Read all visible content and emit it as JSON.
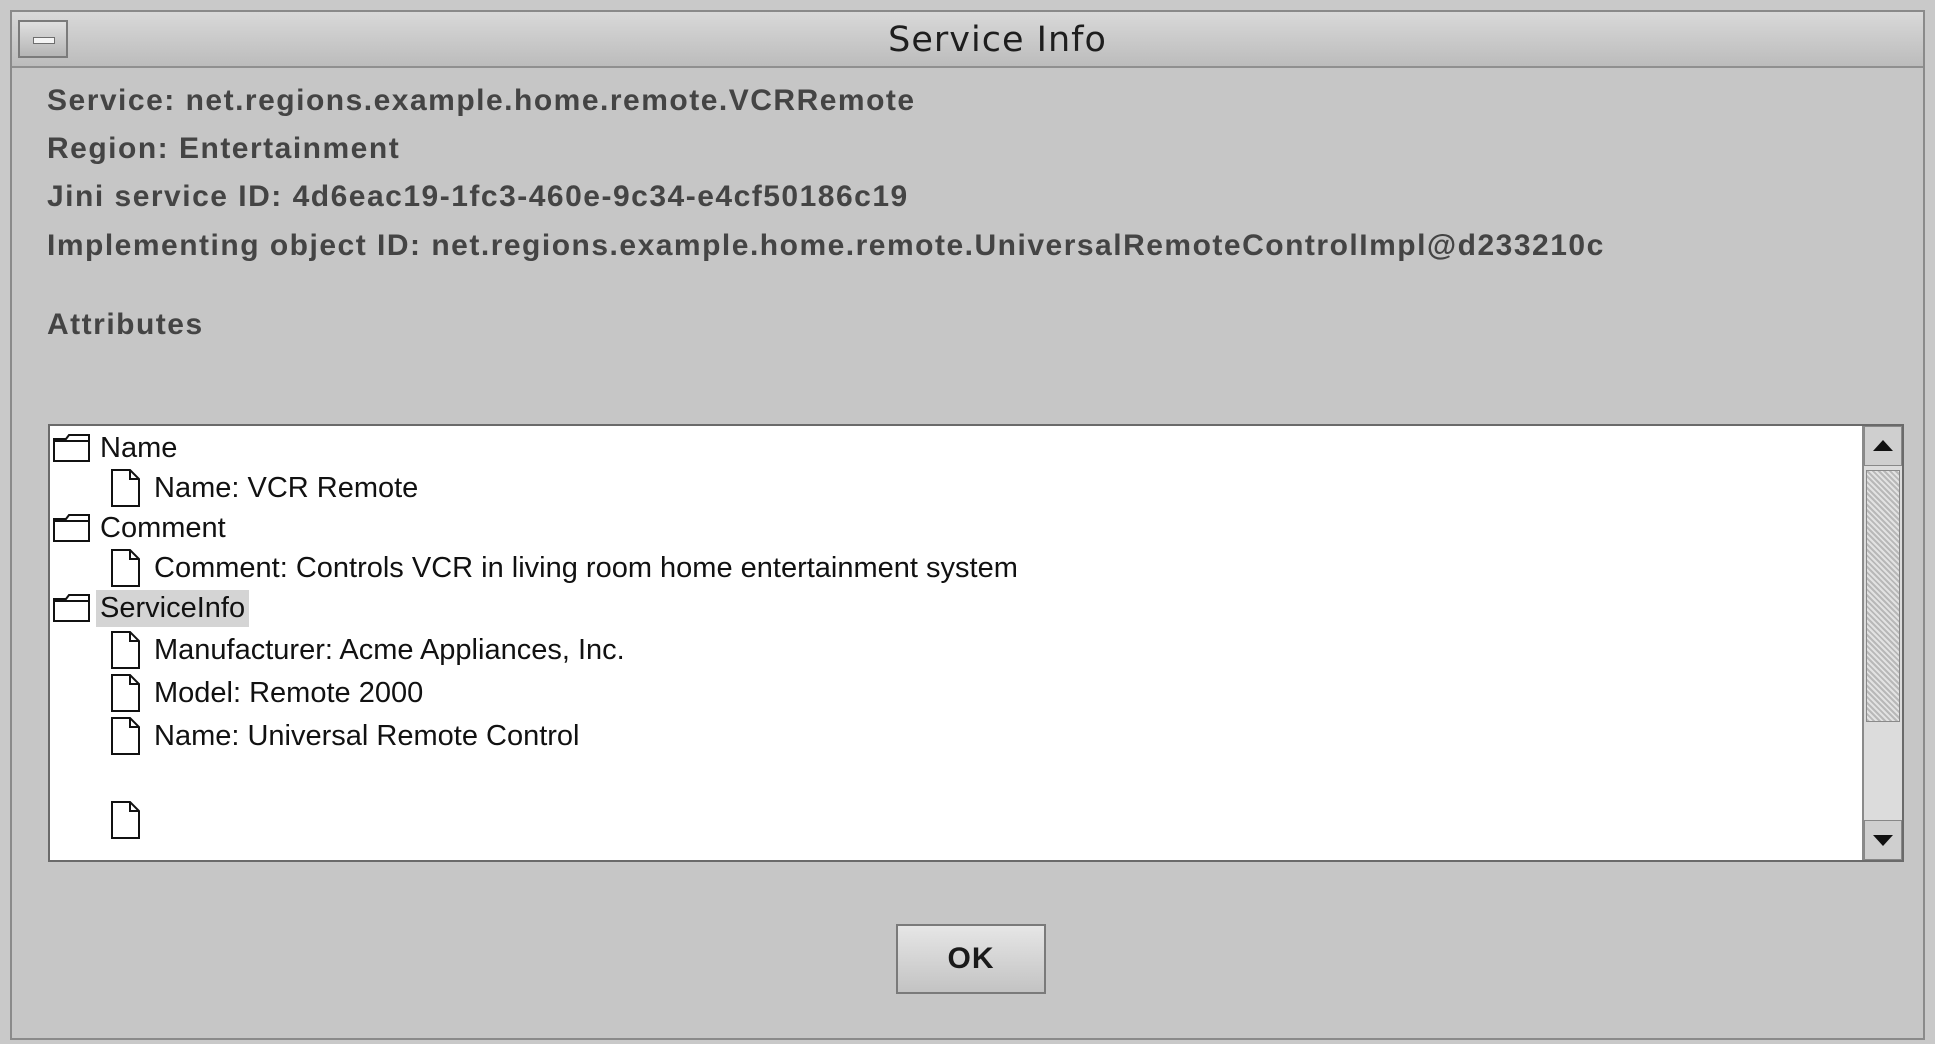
{
  "window": {
    "title": "Service Info"
  },
  "info": {
    "service": "Service: net.regions.example.home.remote.VCRRemote",
    "region": "Region: Entertainment",
    "jini_id": "Jini service ID: 4d6eac19-1fc3-460e-9c34-e4cf50186c19",
    "impl_id": "Implementing object ID: net.regions.example.home.remote.UniversalRemoteControlImpl@d233210c"
  },
  "attributes": {
    "label": "Attributes",
    "tree": [
      {
        "type": "folder",
        "text": "Name"
      },
      {
        "type": "doc",
        "text": "Name: VCR Remote"
      },
      {
        "type": "folder",
        "text": "Comment"
      },
      {
        "type": "doc",
        "text": "Comment: Controls VCR in living room home entertainment system"
      },
      {
        "type": "folder",
        "text": "ServiceInfo",
        "selected": true
      },
      {
        "type": "doc",
        "text": "Manufacturer: Acme Appliances, Inc."
      },
      {
        "type": "doc",
        "text": "Model: Remote 2000"
      },
      {
        "type": "doc",
        "text": "Name: Universal Remote Control"
      }
    ]
  },
  "buttons": {
    "ok": "OK"
  },
  "icons": {
    "window_menu": "window-menu-icon",
    "folder": "folder-icon",
    "document": "document-icon",
    "scroll_up": "scroll-up-arrow-icon",
    "scroll_down": "scroll-down-arrow-icon"
  }
}
